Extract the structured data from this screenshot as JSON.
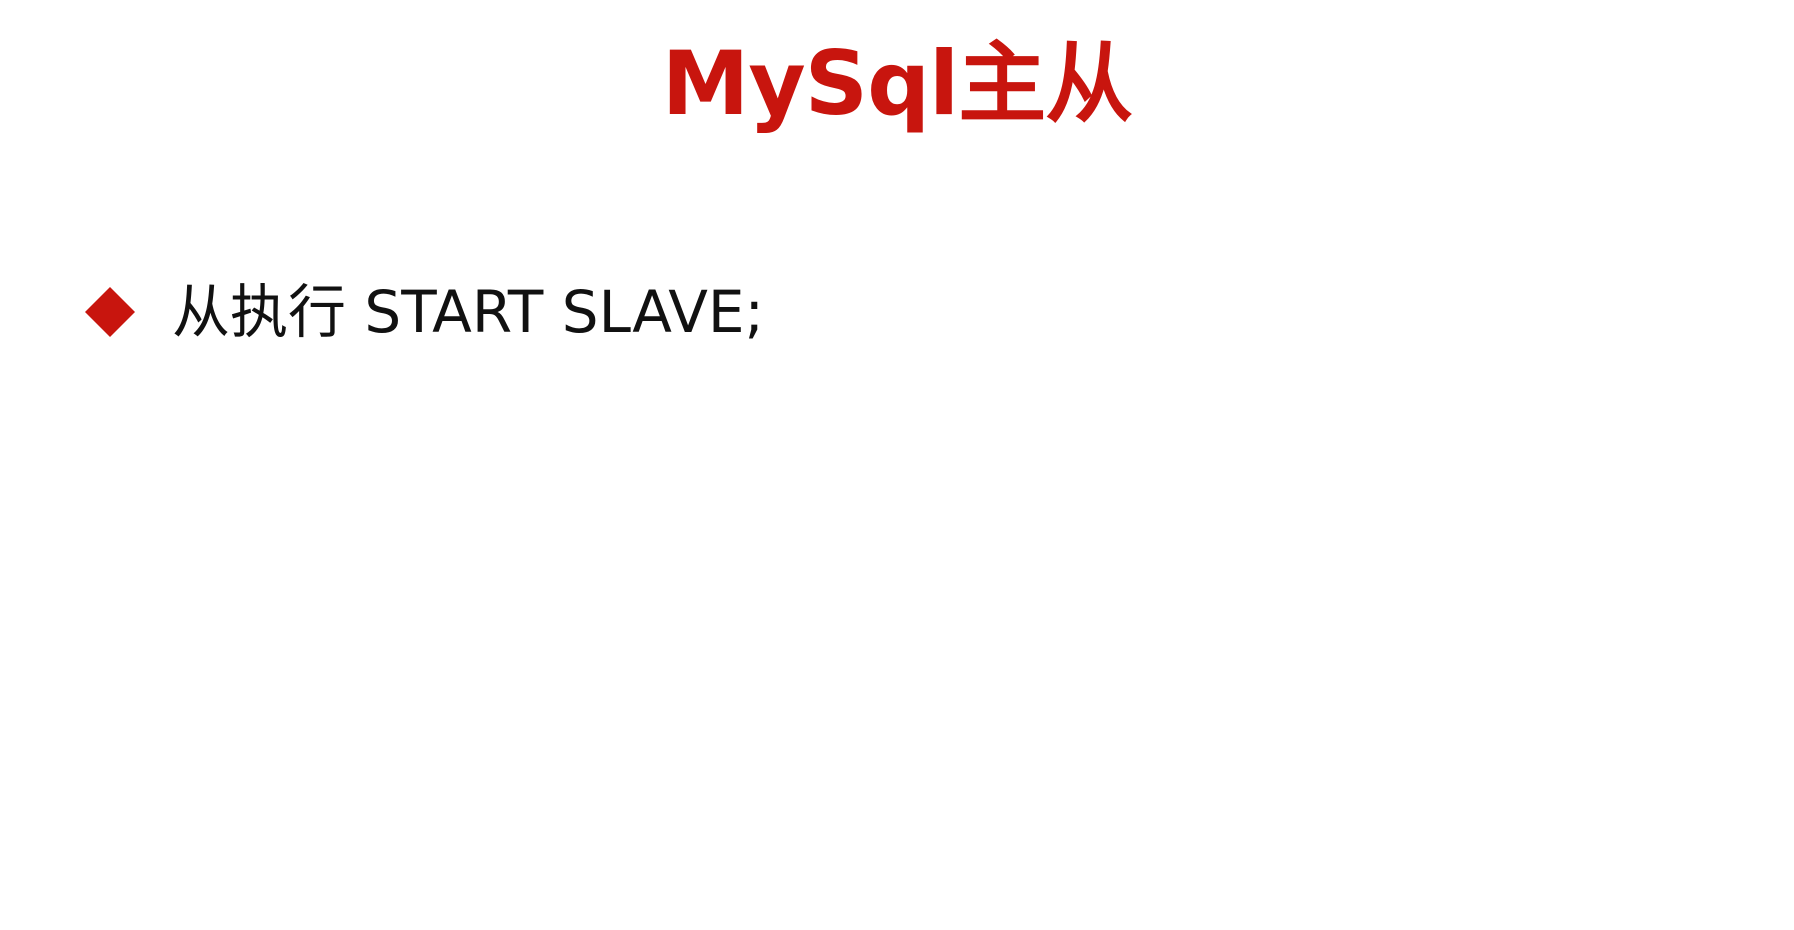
{
  "slide": {
    "title": "MySql主从",
    "accent_color": "#c8150e",
    "bullets": [
      {
        "icon": "diamond-bullet-icon",
        "text": "从执行 START SLAVE;"
      }
    ]
  }
}
